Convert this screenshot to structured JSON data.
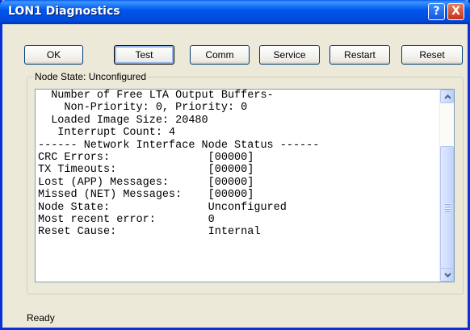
{
  "window": {
    "title": "LON1 Diagnostics"
  },
  "titlebar_buttons": {
    "help": "?",
    "close": "X"
  },
  "toolbar": {
    "buttons": [
      {
        "label": "OK"
      },
      {
        "label": "Test"
      },
      {
        "label": "Comm"
      },
      {
        "label": "Service"
      },
      {
        "label": "Restart"
      },
      {
        "label": "Reset"
      }
    ]
  },
  "group": {
    "label": "Node State: Unconfigured"
  },
  "output": {
    "lines": [
      "  Number of Free LTA Output Buffers-",
      "    Non-Priority: 0, Priority: 0",
      "  Loaded Image Size: 20480",
      "   Interrupt Count: 4",
      "------ Network Interface Node Status ------",
      "CRC Errors:               [00000]",
      "TX Timeouts:              [00000]",
      "Lost (APP) Messages:      [00000]",
      "Missed (NET) Messages:    [00000]",
      "Node State:               Unconfigured",
      "Most recent error:        0",
      "Reset Cause:              Internal"
    ]
  },
  "status": {
    "text": "Ready"
  },
  "colors": {
    "titlebar": "#0054e3",
    "face": "#ece9d8",
    "close": "#c4321a"
  }
}
